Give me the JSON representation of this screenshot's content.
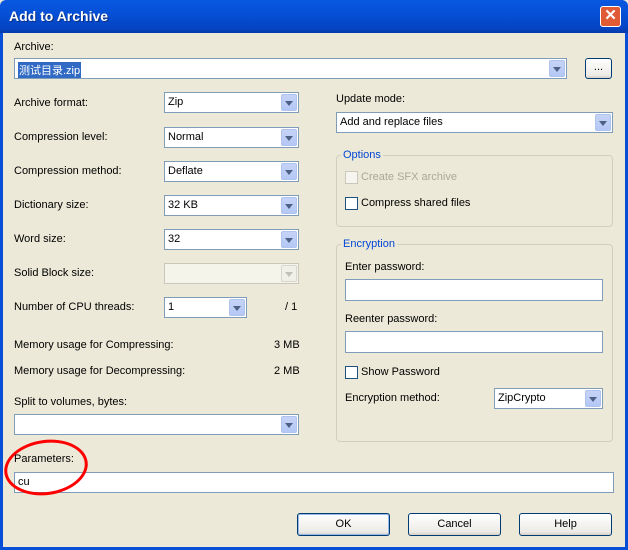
{
  "window": {
    "title": "Add to Archive",
    "close_label": "✕"
  },
  "archive": {
    "label": "Archive:",
    "value": "测试目录.zip",
    "browse_label": "..."
  },
  "left": {
    "format": {
      "label": "Archive format:",
      "value": "Zip"
    },
    "level": {
      "label": "Compression level:",
      "value": "Normal"
    },
    "method": {
      "label": "Compression method:",
      "value": "Deflate"
    },
    "dict": {
      "label": "Dictionary size:",
      "value": "32 KB"
    },
    "word": {
      "label": "Word size:",
      "value": "32"
    },
    "solid": {
      "label": "Solid Block size:",
      "value": ""
    },
    "cpu": {
      "label": "Number of CPU threads:",
      "value": "1",
      "max": "/ 1"
    },
    "mem_comp": {
      "label": "Memory usage for Compressing:",
      "value": "3 MB"
    },
    "mem_decomp": {
      "label": "Memory usage for Decompressing:",
      "value": "2 MB"
    },
    "split": {
      "label": "Split to volumes, bytes:",
      "value": ""
    }
  },
  "params": {
    "label": "Parameters:",
    "value": "cu"
  },
  "right": {
    "update": {
      "label": "Update mode:",
      "value": "Add and replace files"
    },
    "options": {
      "title": "Options",
      "sfx": "Create SFX archive",
      "shared": "Compress shared files"
    },
    "encryption": {
      "title": "Encryption",
      "enter": "Enter password:",
      "reenter": "Reenter password:",
      "show": "Show Password",
      "method_label": "Encryption method:",
      "method_value": "ZipCrypto"
    }
  },
  "buttons": {
    "ok": "OK",
    "cancel": "Cancel",
    "help": "Help"
  },
  "colors": {
    "title_bar": "#0550d6",
    "annotation": "#ff0000"
  }
}
